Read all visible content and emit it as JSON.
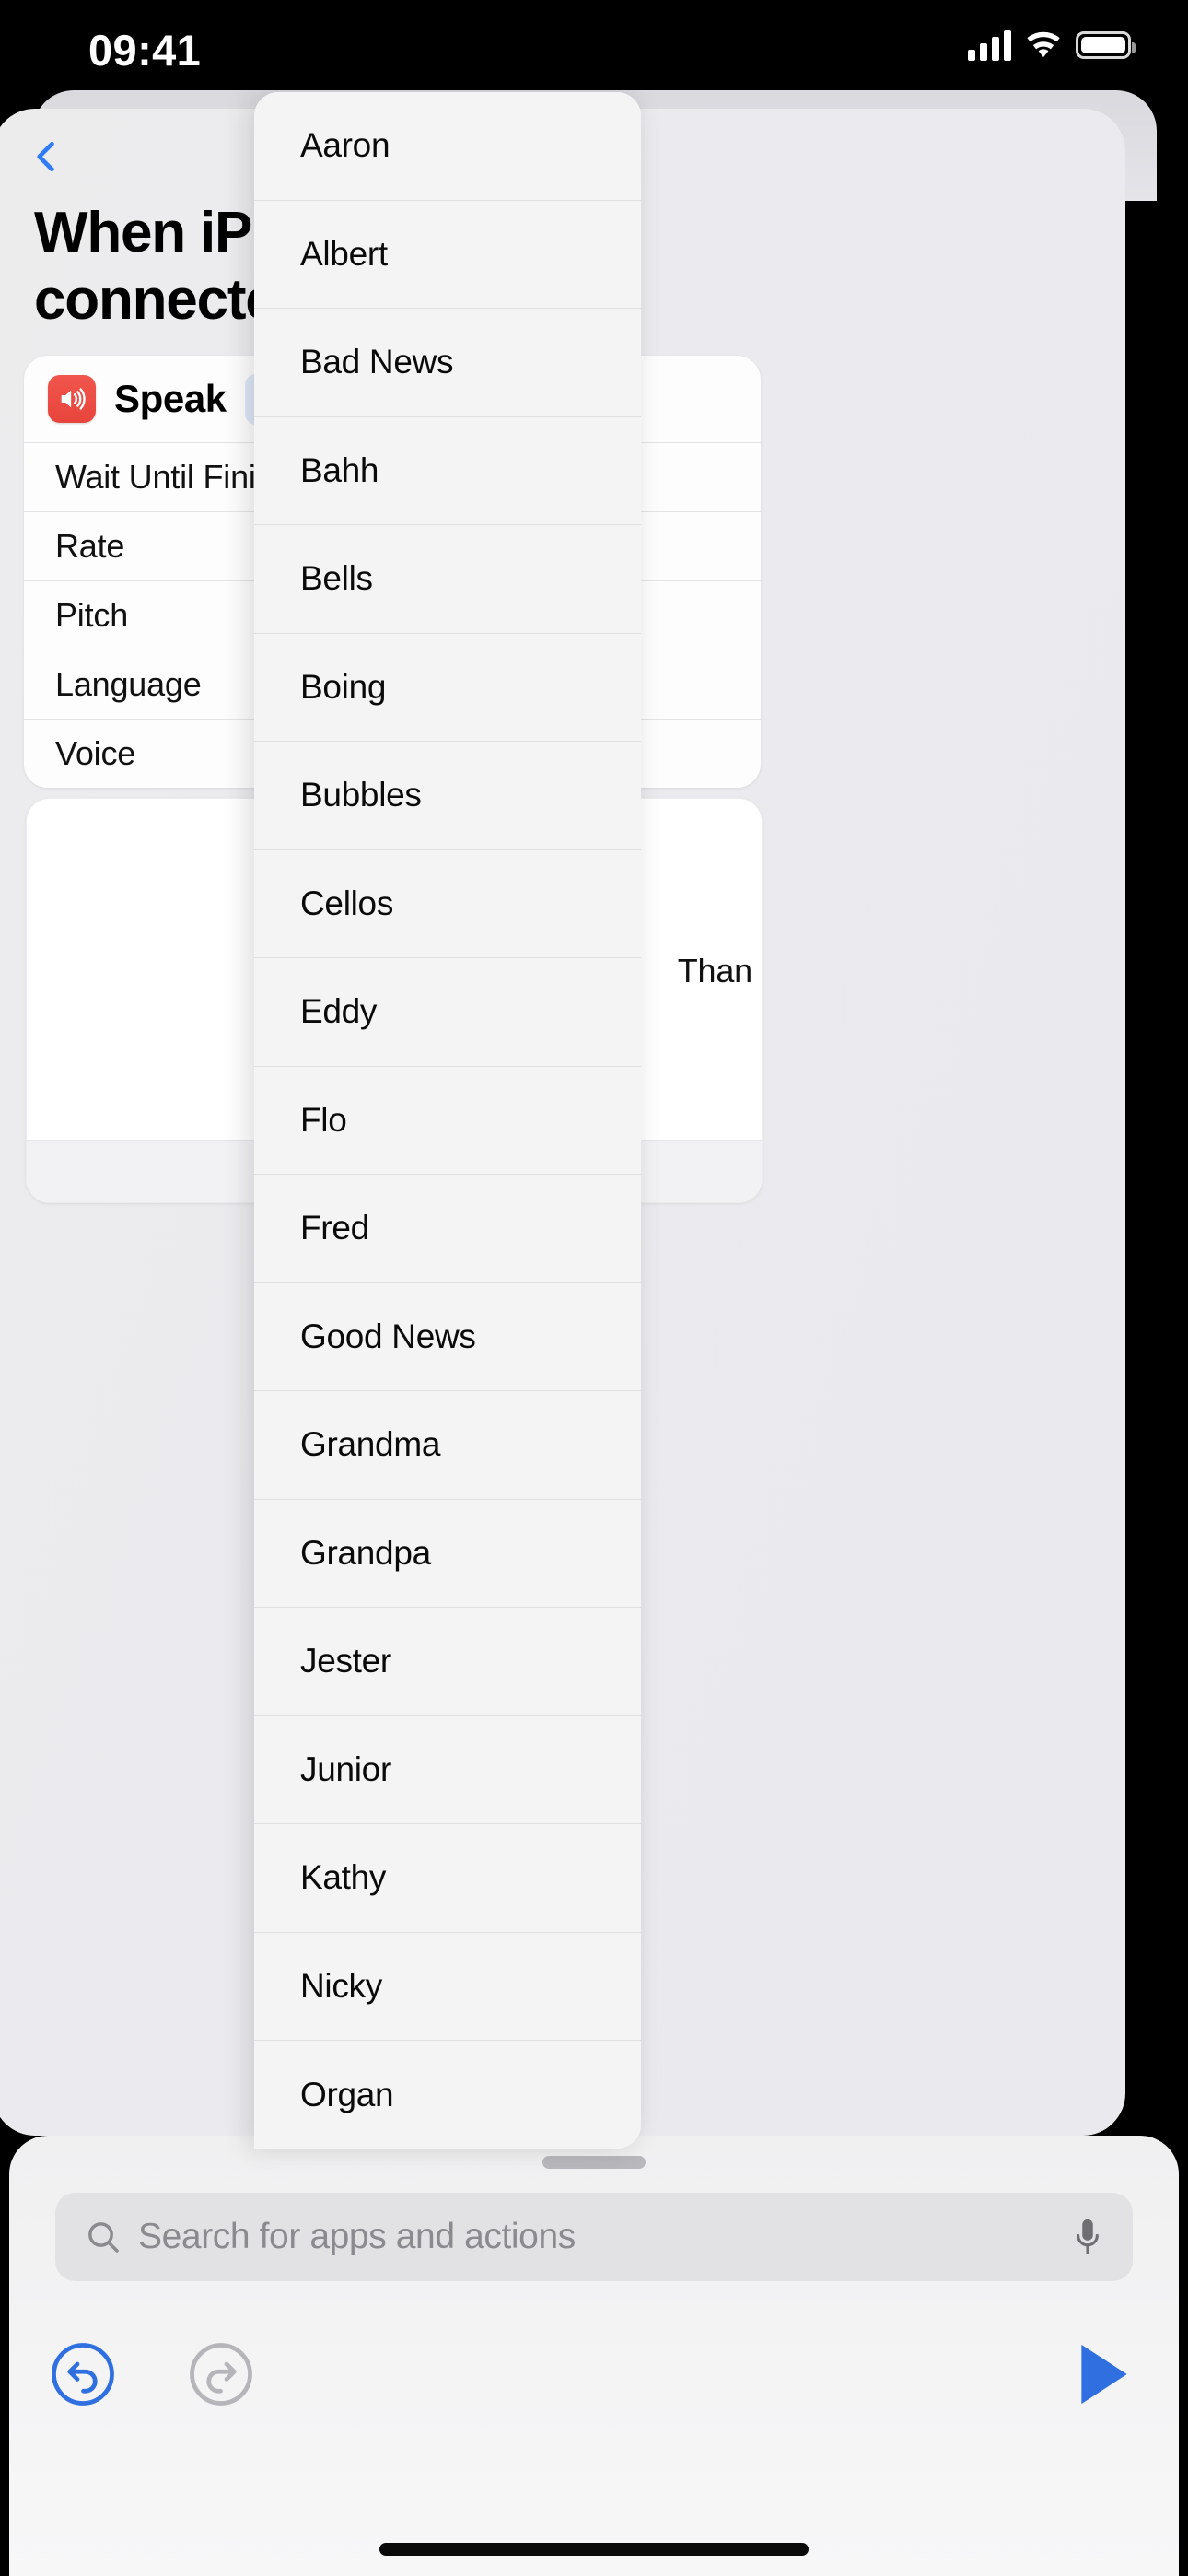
{
  "status_bar": {
    "time": "09:41",
    "cellular_icon": "signal-bars-icon",
    "wifi_icon": "wifi-icon",
    "battery_icon": "battery-icon"
  },
  "editor": {
    "back_icon": "chevron-left-icon",
    "headline_line1": "When iPhone is",
    "headline_line2": "connected to",
    "action": {
      "icon": "speaker-wave-icon",
      "icon_color": "#e8453c",
      "title": "Speak",
      "token_text": "Thank",
      "token_color": "#3a7bf0",
      "rows": [
        {
          "label": "Wait Until Finished"
        },
        {
          "label": "Rate"
        },
        {
          "label": "Pitch"
        },
        {
          "label": "Language"
        },
        {
          "label": "Voice"
        }
      ]
    },
    "text_card": {
      "content": "Than"
    }
  },
  "voice_popover": {
    "items": [
      {
        "label": "Aaron"
      },
      {
        "label": "Albert"
      },
      {
        "label": "Bad News"
      },
      {
        "label": "Bahh"
      },
      {
        "label": "Bells"
      },
      {
        "label": "Boing"
      },
      {
        "label": "Bubbles"
      },
      {
        "label": "Cellos"
      },
      {
        "label": "Eddy"
      },
      {
        "label": "Flo"
      },
      {
        "label": "Fred"
      },
      {
        "label": "Good News"
      },
      {
        "label": "Grandma"
      },
      {
        "label": "Grandpa"
      },
      {
        "label": "Jester"
      },
      {
        "label": "Junior"
      },
      {
        "label": "Kathy"
      },
      {
        "label": "Nicky"
      },
      {
        "label": "Organ"
      }
    ]
  },
  "library": {
    "grabber": "drag-handle",
    "search": {
      "icon": "search-icon",
      "placeholder": "Search for apps and actions",
      "value": "",
      "mic_icon": "microphone-icon"
    },
    "toolbar": {
      "undo_icon": "undo-icon",
      "undo_color": "#2f6fe0",
      "redo_icon": "redo-icon",
      "redo_color": "#b5b5ba",
      "play_icon": "play-icon",
      "play_color": "#2f6fe0"
    }
  }
}
